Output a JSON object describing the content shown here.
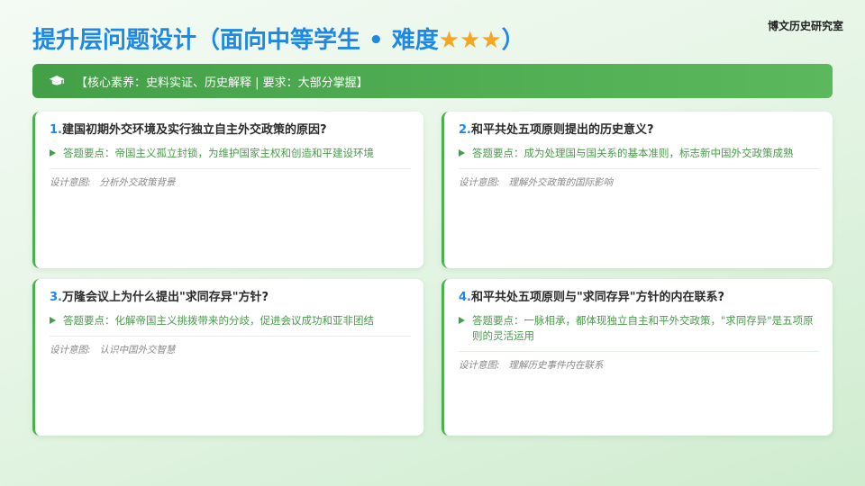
{
  "brand": "博文历史研究室",
  "title": {
    "text": "提升层问题设计（面向中等学生 • 难度",
    "stars": "★★★",
    "close": "）"
  },
  "banner": {
    "icon": "graduation-cap-icon",
    "text": "【核心素养：史料实证、历史解释 | 要求：大部分掌握】"
  },
  "cards": [
    {
      "num": "1.",
      "question": "建国初期外交环境及实行独立自主外交政策的原因?",
      "answer": "答题要点：帝国主义孤立封锁，为维护国家主权和创造和平建设环境",
      "intent_label": "设计意图:",
      "intent": "分析外交政策背景"
    },
    {
      "num": "2.",
      "question": "和平共处五项原则提出的历史意义?",
      "answer": "答题要点：成为处理国与国关系的基本准则，标志新中国外交政策成熟",
      "intent_label": "设计意图:",
      "intent": "理解外交政策的国际影响"
    },
    {
      "num": "3.",
      "question": "万隆会议上为什么提出\"求同存异\"方针?",
      "answer": "答题要点：化解帝国主义挑拨带来的分歧，促进会议成功和亚非团结",
      "intent_label": "设计意图:",
      "intent": "认识中国外交智慧"
    },
    {
      "num": "4.",
      "question": "和平共处五项原则与\"求同存异\"方针的内在联系?",
      "answer": "答题要点：一脉相承，都体现独立自主和平外交政策，\"求同存异\"是五项原则的灵活运用",
      "intent_label": "设计意图:",
      "intent": "理解历史事件内在联系"
    }
  ],
  "colors": {
    "title": "#1e88e5",
    "stars": "#f5a623",
    "banner": "#43a047",
    "answer_text": "#4a9a4a",
    "card_accent": "#4caf50"
  }
}
